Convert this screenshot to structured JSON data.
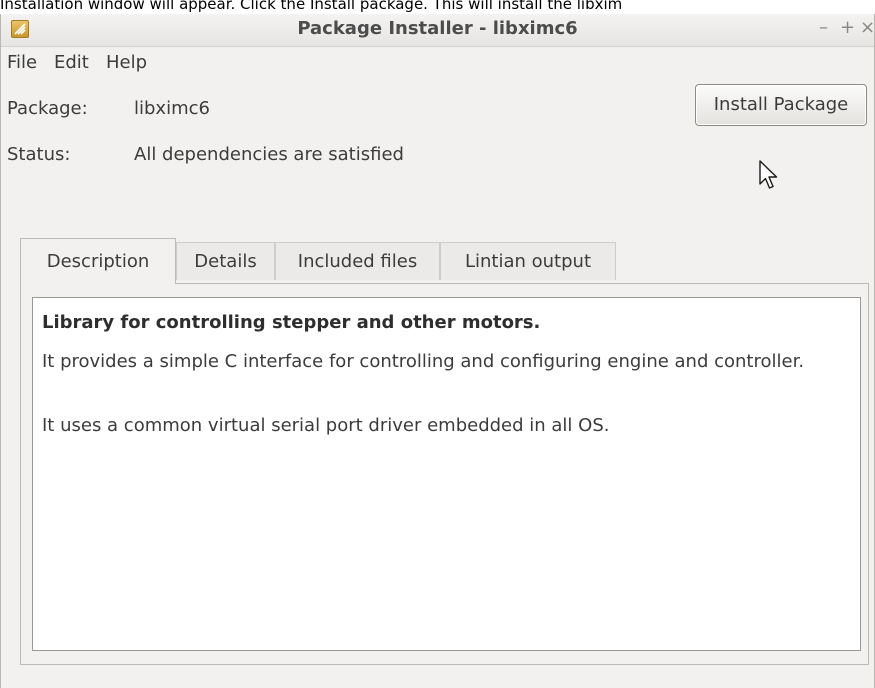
{
  "doc_caption": "Installation window will appear. Click the Install package. This will install the libxim",
  "window": {
    "title": "Package Installer - libximc6",
    "controls": {
      "minimize": "–",
      "maximize": "+",
      "close": "×"
    }
  },
  "menu": [
    "File",
    "Edit",
    "Help"
  ],
  "package": {
    "label": "Package:",
    "value": "libximc6"
  },
  "status": {
    "label": "Status:",
    "value": "All dependencies are satisfied"
  },
  "install_button": "Install Package",
  "tabs": [
    {
      "label": "Description",
      "active": true
    },
    {
      "label": "Details",
      "active": false
    },
    {
      "label": "Included files",
      "active": false
    },
    {
      "label": "Lintian output",
      "active": false
    }
  ],
  "description": {
    "heading": "Library for controlling stepper and other motors.",
    "paragraphs": [
      "It provides a simple C interface for controlling and configuring engine and controller.",
      "It uses a common virtual serial port driver embedded in all OS."
    ]
  },
  "icons": {
    "app": "package-installer-icon",
    "cursor": "mouse-pointer-icon"
  }
}
